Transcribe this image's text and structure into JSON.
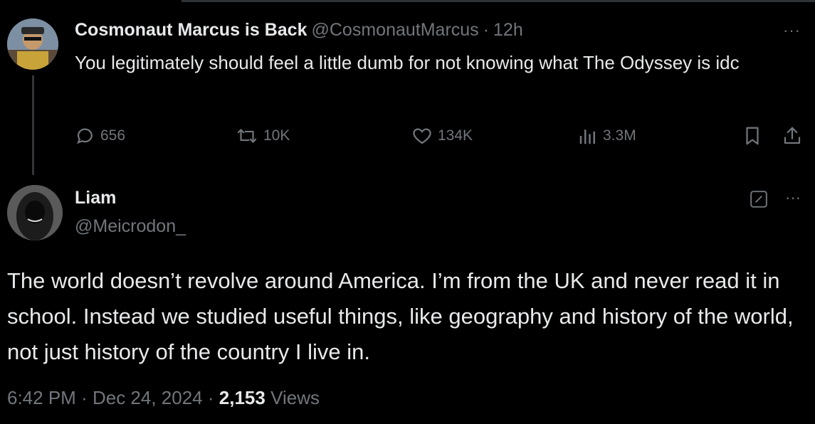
{
  "parent": {
    "name": "Cosmonaut Marcus is Back",
    "handle": "@CosmonautMarcus",
    "dot": "·",
    "time": "12h",
    "more": "···",
    "text": "You legitimately should feel a little dumb for not knowing what The Odyssey is idc",
    "actions": {
      "replies": "656",
      "reposts": "10K",
      "likes": "134K",
      "views": "3.3M"
    }
  },
  "reply": {
    "name": "Liam",
    "handle": "@Meicrodon_",
    "more": "···",
    "text": "The world doesn’t revolve around America.  I’m from the UK and never read it in school. Instead we studied useful things, like geography and history of the world, not just history of the country I live in.",
    "time": "6:42 PM",
    "sep1": "·",
    "date": "Dec 24, 2024",
    "sep2": "·",
    "views_count": "2,153",
    "views_label": "Views"
  },
  "colors": {
    "background": "#000000",
    "text_primary": "#e7e9ea",
    "text_secondary": "#71767b",
    "thread_line": "#333639"
  }
}
